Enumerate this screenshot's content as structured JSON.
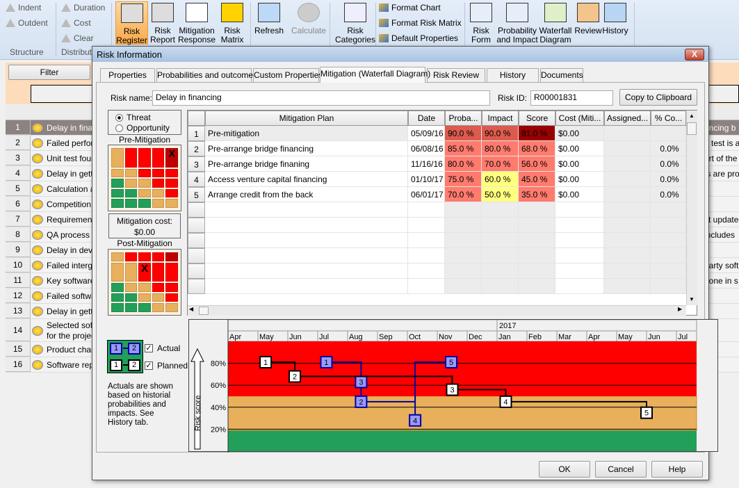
{
  "ribbon": {
    "small_items": [
      {
        "label": "Indent",
        "icon": "indent-arrow-icon",
        "enabled": false
      },
      {
        "label": "Outdent",
        "icon": "outdent-arrow-icon",
        "enabled": false
      },
      {
        "label": "Duration",
        "icon": "duration-distribution-icon",
        "enabled": false
      },
      {
        "label": "Cost",
        "icon": "cost-distribution-icon",
        "enabled": false
      },
      {
        "label": "Clear",
        "icon": "clear-distribution-icon",
        "enabled": false
      },
      {
        "label": "Format Chart",
        "icon": "format-chart-icon",
        "enabled": true
      },
      {
        "label": "Format Risk Matrix",
        "icon": "format-risk-matrix-icon",
        "enabled": true
      },
      {
        "label": "Default Properties",
        "icon": "default-properties-icon",
        "enabled": true
      }
    ],
    "big_buttons": [
      {
        "label": "Risk\nRegister",
        "icon": "risk-register-icon",
        "active": true
      },
      {
        "label": "Risk\nReport",
        "icon": "risk-report-icon"
      },
      {
        "label": "Mitigation\nResponse",
        "icon": "mitigation-response-icon"
      },
      {
        "label": "Risk\nMatrix",
        "icon": "risk-matrix-icon"
      },
      {
        "label": "Refresh",
        "icon": "refresh-icon"
      },
      {
        "label": "Calculate",
        "icon": "calculator-icon",
        "disabled": true
      },
      {
        "label": "Risk\nCategories",
        "icon": "risk-categories-icon"
      },
      {
        "label": "Risk\nForm",
        "icon": "risk-form-icon"
      },
      {
        "label": "Probability\nand Impact",
        "icon": "probability-impact-icon"
      },
      {
        "label": "Waterfall\nDiagram",
        "icon": "waterfall-diagram-icon"
      },
      {
        "label": "Review",
        "icon": "review-icon"
      },
      {
        "label": "History",
        "icon": "history-icon"
      }
    ],
    "groups": [
      "Structure",
      "Distribut"
    ]
  },
  "register": {
    "filter_label": "Filter",
    "rows": [
      {
        "num": "1",
        "text": "Delay in finan",
        "right": "ancing b",
        "selected": true
      },
      {
        "num": "2",
        "text": "Failed perforr",
        "right": "e test is a"
      },
      {
        "num": "3",
        "text": "Unit test foun",
        "right": "art of the"
      },
      {
        "num": "4",
        "text": "Delay in gettir",
        "right": "ts are pro"
      },
      {
        "num": "5",
        "text": "Calculation al",
        "right": ""
      },
      {
        "num": "6",
        "text": "Competition o",
        "right": ""
      },
      {
        "num": "7",
        "text": "Requirement",
        "right": "st update"
      },
      {
        "num": "8",
        "text": "QA process t",
        "right": "includes"
      },
      {
        "num": "9",
        "text": "Delay in deve",
        "right": ""
      },
      {
        "num": "10",
        "text": "Failed intergra",
        "right": "party soft"
      },
      {
        "num": "11",
        "text": "Key software",
        "right": "done in s"
      },
      {
        "num": "12",
        "text": "Failed softwa",
        "right": ""
      },
      {
        "num": "13",
        "text": "Delay in gettir",
        "right": ""
      },
      {
        "num": "14",
        "text": "Selected soft\nfor the projec",
        "right": ""
      },
      {
        "num": "15",
        "text": "Product cham",
        "right": ""
      },
      {
        "num": "16",
        "text": "Software rep",
        "right": ""
      }
    ]
  },
  "dialog": {
    "title": "Risk Information",
    "close_label": "X",
    "tabs": [
      "Properties",
      "Probabilities and outcomes",
      "Custom Properties",
      "Mitigation (Waterfall Diagram)",
      "Risk Review",
      "History",
      "Documents"
    ],
    "active_tab": 3,
    "risk_name_label": "Risk name:",
    "risk_name": "Delay in financing",
    "risk_id_label": "Risk ID:",
    "risk_id": "R00001831",
    "copy_button": "Copy to Clipboard",
    "threat_label": "Threat",
    "opportunity_label": "Opportunity",
    "selected_type": "Threat",
    "pre_label": "Pre-Mitigation",
    "post_label": "Post-Mitigation",
    "cost_label": "Mitigation cost:",
    "cost_value": "$0.00",
    "matrix_colors": {
      "G": "#22a05a",
      "O": "#e8b05c",
      "R": "#ff0000",
      "D": "#c00000"
    },
    "pre_matrix": [
      "ORRRD",
      "OORRR",
      "GOORR",
      "GGOOR",
      "GGGOO"
    ],
    "pre_marker": {
      "row": 1,
      "col": 5,
      "symbol": "X"
    },
    "post_matrix": [
      "ORRRD",
      "OORRR",
      "GOORR",
      "GGOOR",
      "GGGOO"
    ],
    "post_marker": {
      "row": 2,
      "col": 3,
      "symbol": "X"
    },
    "columns": [
      "",
      "Mitigation Plan",
      "Date",
      "Proba...",
      "Impact",
      "Score",
      "Cost (Miti...",
      "Assigned...",
      "% Co..."
    ],
    "rows": [
      {
        "n": "1",
        "plan": "Pre-mitigation",
        "date": "05/09/16",
        "prob": "90.0 %",
        "impact": "90.0 %",
        "score": "81.0 %",
        "cost": "$0.00",
        "assigned": "",
        "pct": "",
        "colors": [
          "#dc5a4e",
          "#dc5a4e",
          "#990000"
        ]
      },
      {
        "n": "2",
        "plan": "Pre-arrange bridge financing",
        "date": "06/08/16",
        "prob": "85.0 %",
        "impact": "80.0 %",
        "score": "68.0 %",
        "cost": "$0.00",
        "assigned": "",
        "pct": "0.0%",
        "colors": [
          "#ff7b6e",
          "#ff7b6e",
          "#ff7b6e"
        ]
      },
      {
        "n": "3",
        "plan": "Pre-arrange bridge finaning",
        "date": "11/16/16",
        "prob": "80.0 %",
        "impact": "70.0 %",
        "score": "56.0 %",
        "cost": "$0.00",
        "assigned": "",
        "pct": "0.0%",
        "colors": [
          "#ff7b6e",
          "#ff7b6e",
          "#ff7b6e"
        ]
      },
      {
        "n": "4",
        "plan": "Access venture capital financing",
        "date": "01/10/17",
        "prob": "75.0 %",
        "impact": "60.0 %",
        "score": "45.0 %",
        "cost": "$0.00",
        "assigned": "",
        "pct": "0.0%",
        "colors": [
          "#ff7b6e",
          "#ffff80",
          "#ff7b6e"
        ]
      },
      {
        "n": "5",
        "plan": "Arrange credit from the back",
        "date": "06/01/17",
        "prob": "70.0 %",
        "impact": "50.0 %",
        "score": "35.0 %",
        "cost": "$0.00",
        "assigned": "",
        "pct": "0.0%",
        "colors": [
          "#ff7b6e",
          "#ffff80",
          "#ff7b6e"
        ]
      }
    ],
    "legend": {
      "actual_label": "Actual",
      "planned_label": "Planned",
      "actual_checked": true,
      "planned_checked": true,
      "sample": [
        "1",
        "2"
      ]
    },
    "note": "Actuals are shown based on historial probabilities and impacts. See History tab.",
    "buttons": {
      "ok": "OK",
      "cancel": "Cancel",
      "help": "Help"
    }
  },
  "chart_data": {
    "type": "line",
    "ylabel": "Risk score",
    "year_label": "2017",
    "months": [
      "Apr",
      "May",
      "Jun",
      "Jul",
      "Aug",
      "Sep",
      "Oct",
      "Nov",
      "Dec",
      "Jan",
      "Feb",
      "Mar",
      "Apr",
      "May",
      "Jun",
      "Jul"
    ],
    "xlim": [
      "2016-04-01",
      "2017-07-22"
    ],
    "ylim": [
      0,
      100
    ],
    "yticks": [
      "80%",
      "60%",
      "40%",
      "20%"
    ],
    "yticks_values": [
      80,
      60,
      40,
      20
    ],
    "bands": [
      {
        "from": 0,
        "to": 19,
        "color": "#22a05a"
      },
      {
        "from": 19,
        "to": 50,
        "color": "#e8b05c"
      },
      {
        "from": 50,
        "to": 100,
        "color": "#ff0000"
      }
    ],
    "series": [
      {
        "name": "Planned",
        "color": "#000000",
        "fill": "#ffffff",
        "points": [
          {
            "label": "1",
            "date": "2016-05-09",
            "score": 81
          },
          {
            "label": "2",
            "date": "2016-06-08",
            "score": 68
          },
          {
            "label": "3",
            "date": "2016-11-16",
            "score": 56
          },
          {
            "label": "4",
            "date": "2017-01-10",
            "score": 45
          },
          {
            "label": "5",
            "date": "2017-06-01",
            "score": 35
          }
        ]
      },
      {
        "name": "Actual",
        "color": "#0000a0",
        "fill": "#9999ff",
        "points": [
          {
            "label": "1",
            "date": "2016-07-10",
            "score": 81
          },
          {
            "label": "3",
            "date": "2016-08-15",
            "score": 63
          },
          {
            "label": "2",
            "date": "2016-08-15",
            "score": 45
          },
          {
            "label": "4",
            "date": "2016-10-09",
            "score": 28
          },
          {
            "label": "5",
            "date": "2016-11-15",
            "score": 81
          }
        ]
      }
    ]
  }
}
